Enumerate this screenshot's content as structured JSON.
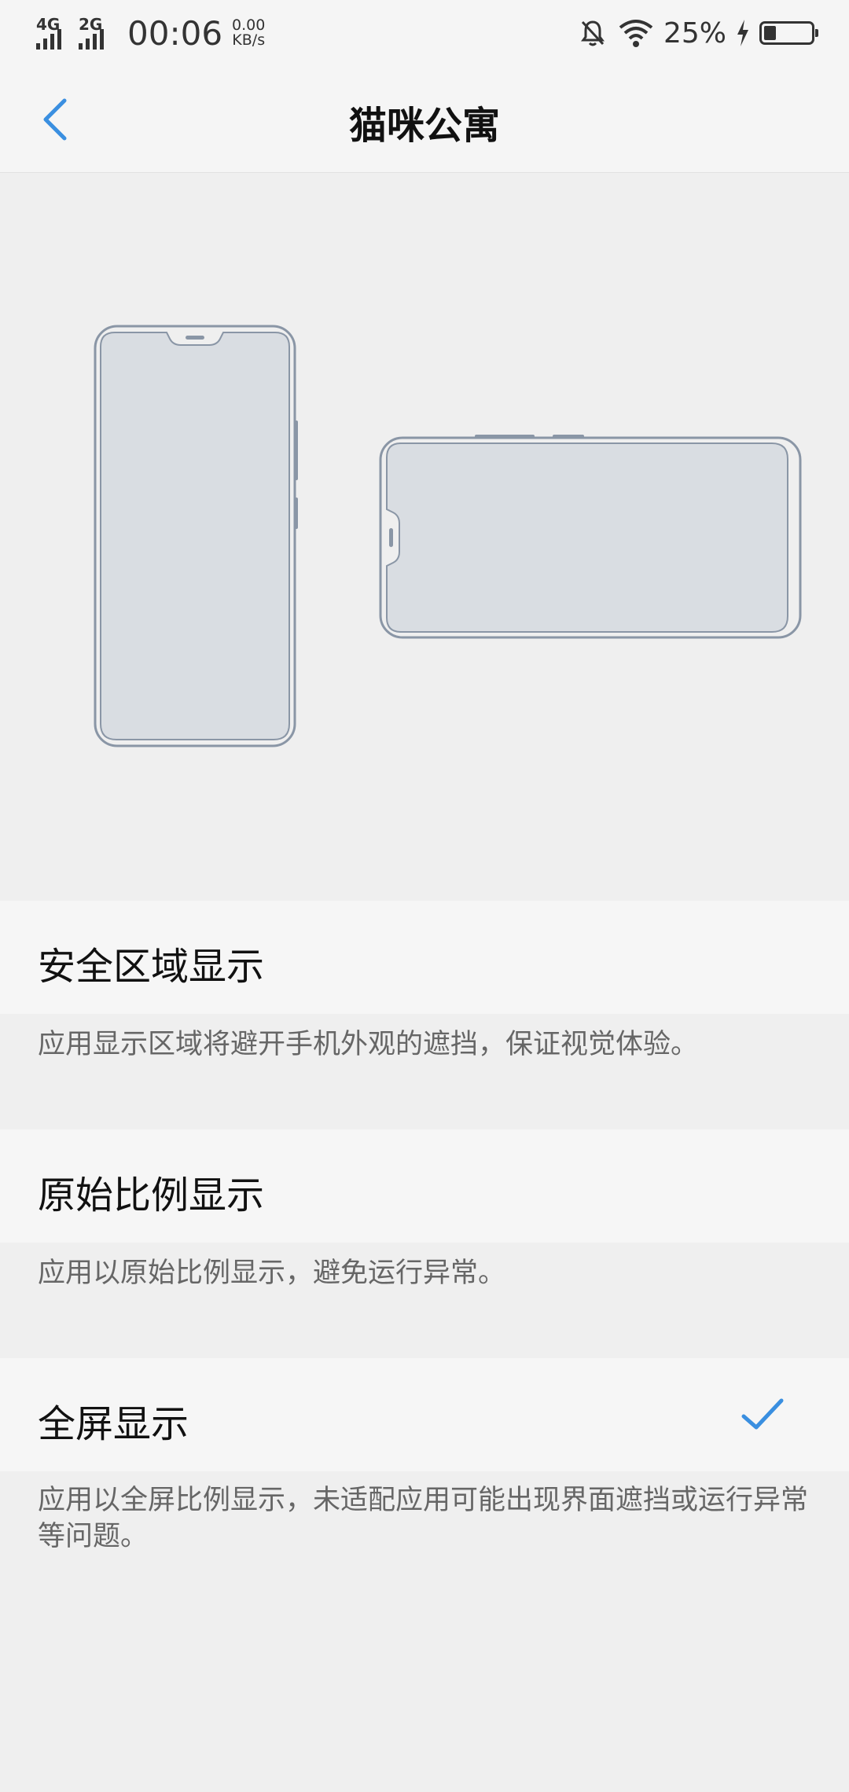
{
  "status_bar": {
    "net1": "4G",
    "net2": "2G",
    "time": "00:06",
    "speed_value": "0.00",
    "speed_unit": "KB/s",
    "battery_pct": "25%",
    "battery_level": 0.25,
    "icons": [
      "signal-icon",
      "mute-bell-icon",
      "wifi-icon",
      "charging-icon",
      "battery-icon"
    ]
  },
  "header": {
    "title": "猫咪公寓",
    "back_icon": "chevron-left-icon"
  },
  "options": [
    {
      "label": "安全区域显示",
      "description": "应用显示区域将避开手机外观的遮挡，保证视觉体验。",
      "selected": false
    },
    {
      "label": "原始比例显示",
      "description": "应用以原始比例显示，避免运行异常。",
      "selected": false
    },
    {
      "label": "全屏显示",
      "description": "应用以全屏比例显示，未适配应用可能出现界面遮挡或运行异常等问题。",
      "selected": true
    }
  ],
  "colors": {
    "accent": "#3a8fe0",
    "background": "#efefef",
    "row_background": "#f6f6f6",
    "phone_outline": "#8a96a6",
    "phone_screen": "#d9dde2"
  }
}
